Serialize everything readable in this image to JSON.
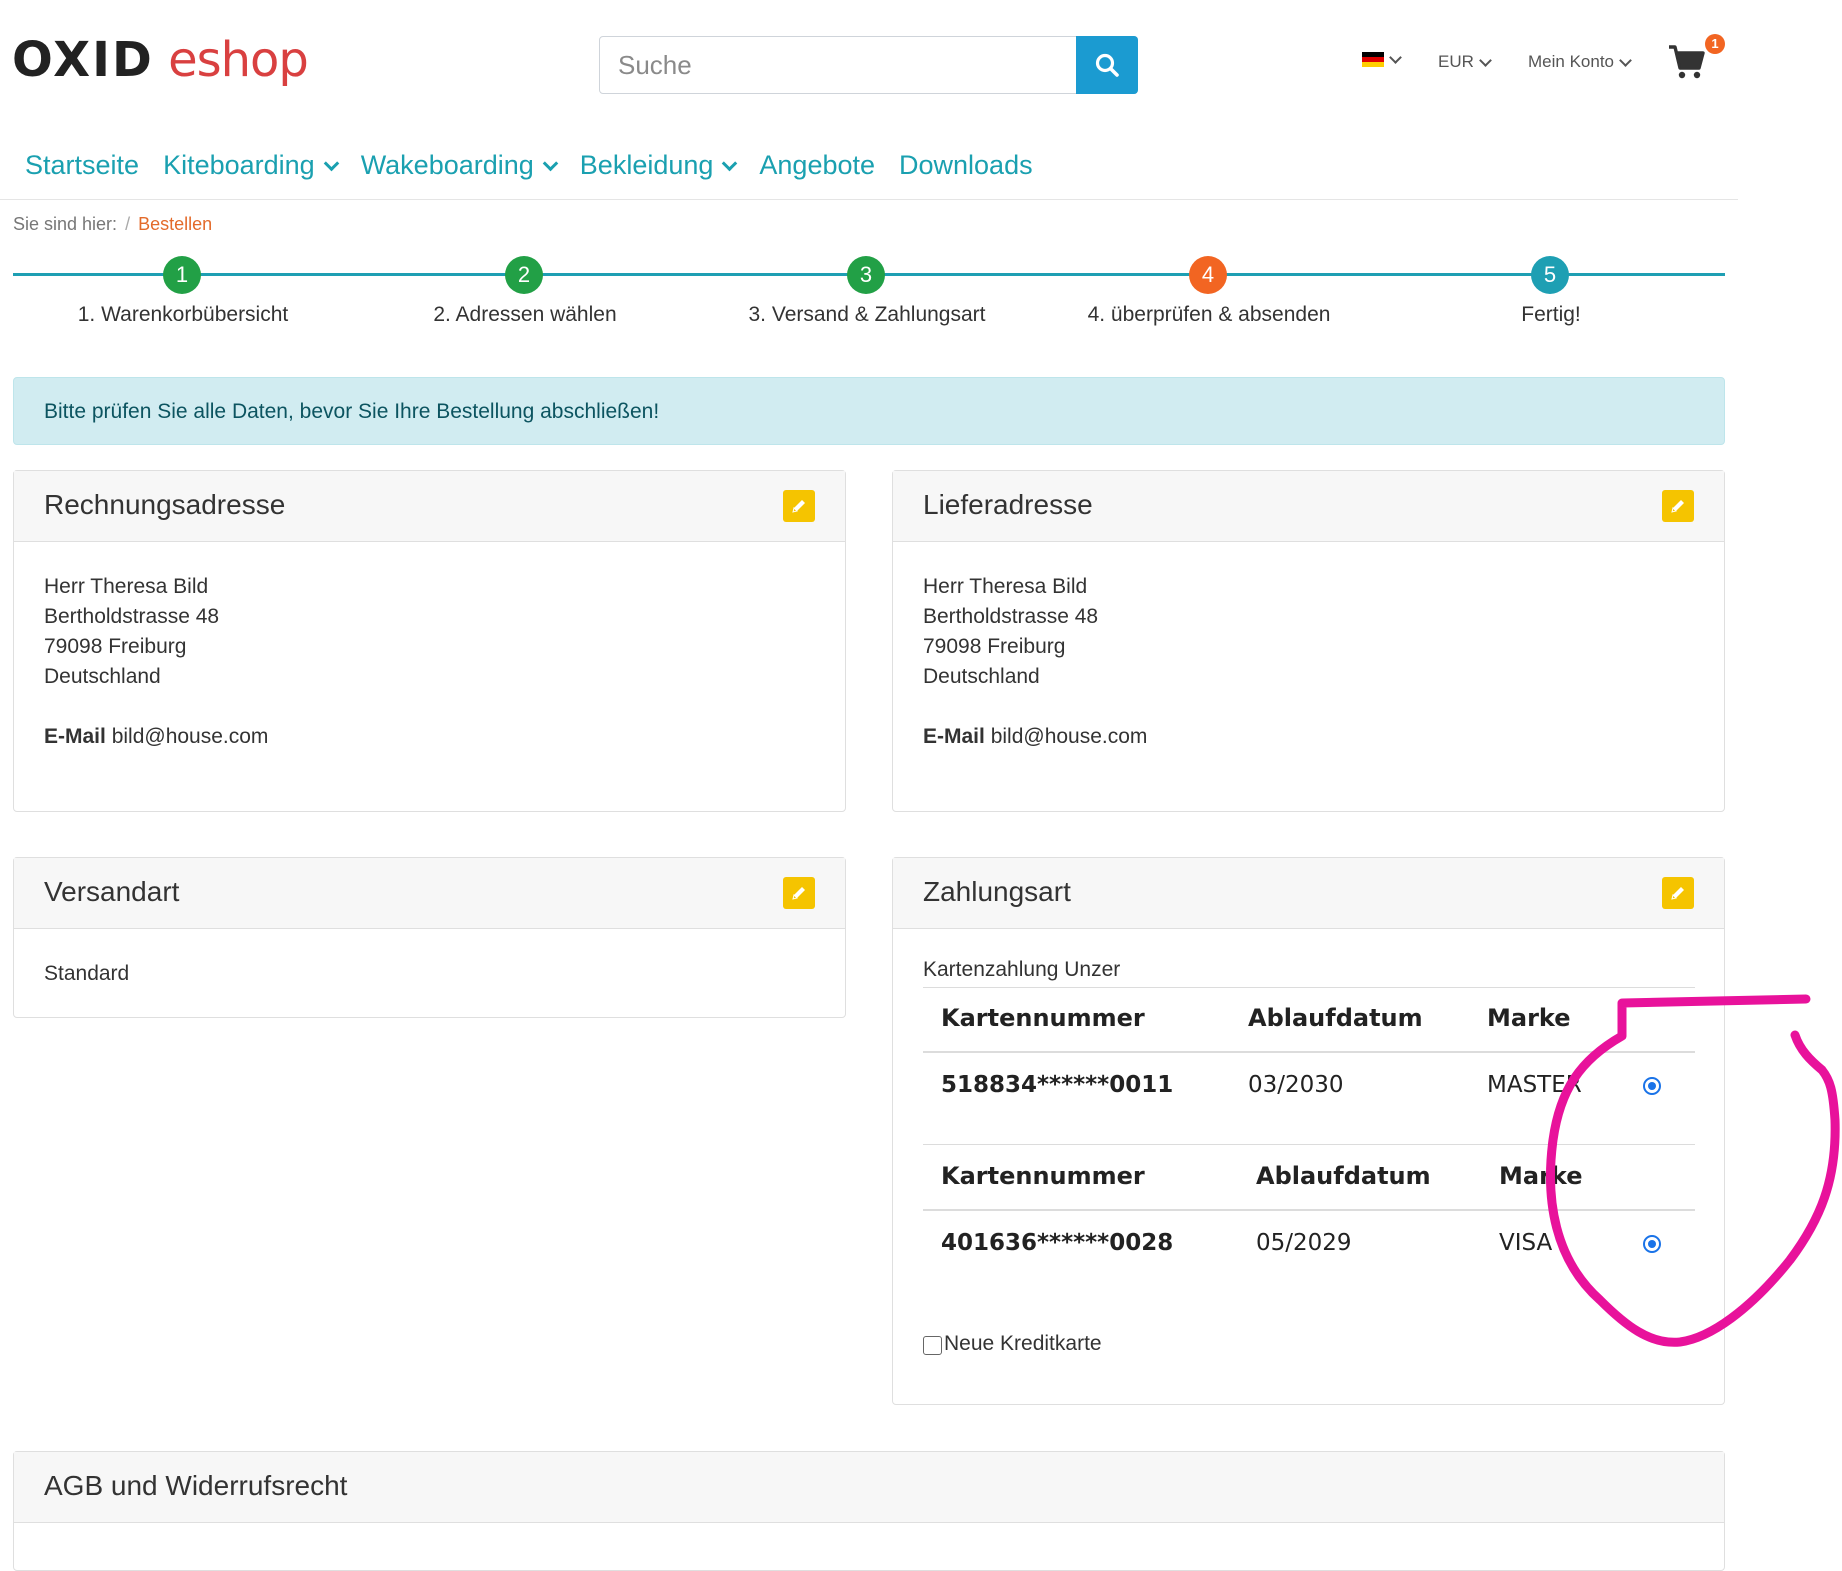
{
  "header": {
    "logo_part1": "OXID",
    "logo_part2": "eshop",
    "search_placeholder": "Suche",
    "currency": "EUR",
    "account": "Mein Konto",
    "cart_count": "1"
  },
  "nav": {
    "items": [
      "Startseite",
      "Kiteboarding",
      "Wakeboarding",
      "Bekleidung",
      "Angebote",
      "Downloads"
    ]
  },
  "breadcrumb": {
    "label": "Sie sind hier:",
    "separator": "/",
    "current": "Bestellen"
  },
  "steps": [
    {
      "num": "1",
      "label": "1. Warenkorbübersicht",
      "color": "#22a046"
    },
    {
      "num": "2",
      "label": "2. Adressen wählen",
      "color": "#22a046"
    },
    {
      "num": "3",
      "label": "3. Versand & Zahlungsart",
      "color": "#22a046"
    },
    {
      "num": "4",
      "label": "4. überprüfen & absenden",
      "color": "#f26522"
    },
    {
      "num": "5",
      "label": "Fertig!",
      "color": "#1e9fb3"
    }
  ],
  "alert": "Bitte prüfen Sie alle Daten, bevor Sie Ihre Bestellung abschließen!",
  "billing": {
    "title": "Rechnungsadresse",
    "lines": [
      "Herr Theresa Bild",
      "Bertholdstrasse 48",
      "79098 Freiburg",
      "Deutschland"
    ],
    "email_label": "E-Mail",
    "email": "bild@house.com"
  },
  "shipping_address": {
    "title": "Lieferadresse",
    "lines": [
      "Herr Theresa Bild",
      "Bertholdstrasse 48",
      "79098 Freiburg",
      "Deutschland"
    ],
    "email_label": "E-Mail",
    "email": "bild@house.com"
  },
  "shipping_method": {
    "title": "Versandart",
    "value": "Standard"
  },
  "payment": {
    "title": "Zahlungsart",
    "method": "Kartenzahlung Unzer",
    "cards": [
      {
        "h_number": "Kartennummer",
        "h_expiry": "Ablaufdatum",
        "h_brand": "Marke",
        "number": "518834******0011",
        "expiry": "03/2030",
        "brand": "MASTER"
      },
      {
        "h_number": "Kartennummer",
        "h_expiry": "Ablaufdatum",
        "h_brand": "Marke",
        "number": "401636******0028",
        "expiry": "05/2029",
        "brand": "VISA"
      }
    ],
    "new_card_label": "Neue Kreditkarte"
  },
  "terms": {
    "title": "AGB und Widerrufsrecht"
  },
  "colors": {
    "link": "#1aa0b0",
    "search_button": "#1b9bd1",
    "edit_button": "#f5c400",
    "annotation": "#e8129b"
  }
}
